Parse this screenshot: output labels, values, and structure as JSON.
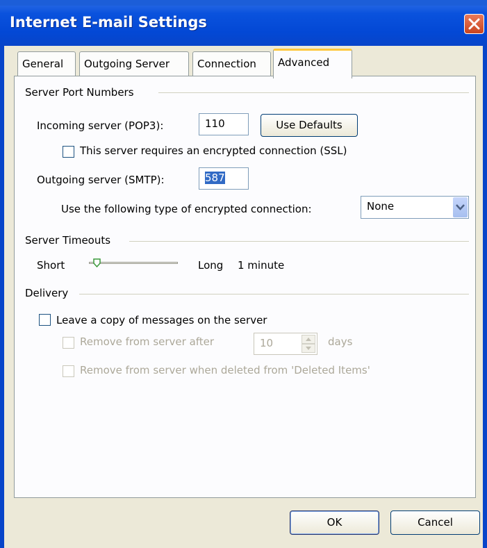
{
  "window": {
    "title": "Internet E-mail Settings"
  },
  "tabs": [
    {
      "label": "General"
    },
    {
      "label": "Outgoing Server"
    },
    {
      "label": "Connection"
    },
    {
      "label": "Advanced"
    }
  ],
  "server_ports": {
    "heading": "Server Port Numbers",
    "incoming_label": "Incoming server (POP3):",
    "incoming_value": "110",
    "use_defaults_label": "Use Defaults",
    "ssl_label": "This server requires an encrypted connection (SSL)",
    "outgoing_label": "Outgoing server (SMTP):",
    "outgoing_value": "587",
    "encryption_label": "Use the following type of encrypted connection:",
    "encryption_value": "None"
  },
  "timeouts": {
    "heading": "Server Timeouts",
    "short_label": "Short",
    "long_label": "Long",
    "value_label": "1 minute",
    "slider_level": 0.05
  },
  "delivery": {
    "heading": "Delivery",
    "leave_copy_label": "Leave a copy of messages on the server",
    "remove_after_label": "Remove from server after",
    "days_value": "10",
    "days_label": "days",
    "remove_deleted_label": "Remove from server when deleted from 'Deleted Items'"
  },
  "footer": {
    "ok_label": "OK",
    "cancel_label": "Cancel"
  },
  "colors": {
    "titlebar": "#0348d5",
    "dialog_bg": "#ece9d8",
    "panel_bg": "#fcfcfe",
    "active_tab_accent": "#ffc83c",
    "selection": "#316ac5"
  }
}
